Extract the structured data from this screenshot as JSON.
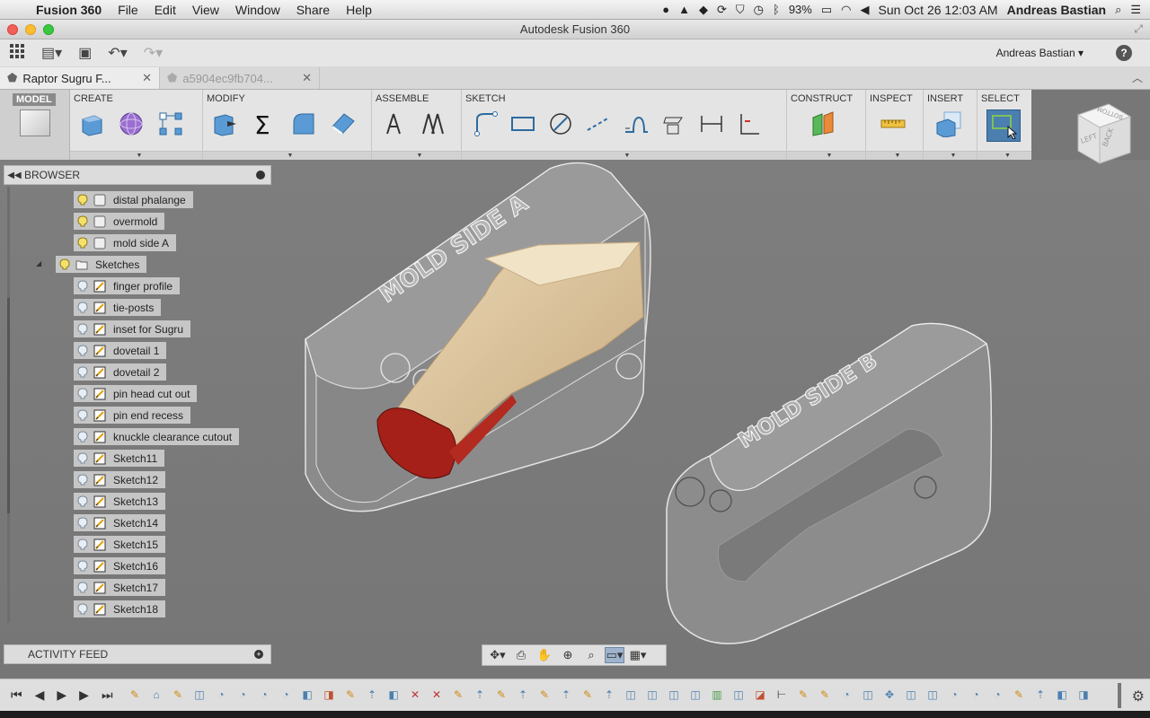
{
  "menubar": {
    "app_name": "Fusion 360",
    "menus": [
      "File",
      "Edit",
      "View",
      "Window",
      "Share",
      "Help"
    ],
    "battery": "93%",
    "datetime": "Sun Oct 26  12:03 AM",
    "user": "Andreas Bastian"
  },
  "window": {
    "title": "Autodesk Fusion 360"
  },
  "qat": {
    "user": "Andreas Bastian ▾",
    "help": "?"
  },
  "tabs": [
    {
      "label": "Raptor Sugru F..."
    },
    {
      "label": "a5904ec9fb704..."
    }
  ],
  "ribbon": {
    "workspace": "MODEL",
    "groups": {
      "create": "CREATE",
      "modify": "MODIFY",
      "assemble": "ASSEMBLE",
      "sketch": "SKETCH",
      "construct": "CONSTRUCT",
      "inspect": "INSPECT",
      "insert": "INSERT",
      "select": "SELECT"
    }
  },
  "browser": {
    "title": "BROWSER",
    "bodies": [
      "distal phalange",
      "overmold",
      "mold side A"
    ],
    "sketches_folder": "Sketches",
    "sketches": [
      "finger profile",
      "tie-posts",
      "inset for Sugru",
      "dovetail 1",
      "dovetail 2",
      "pin head cut out",
      "pin end recess",
      "knuckle clearance cutout",
      "Sketch11",
      "Sketch12",
      "Sketch13",
      "Sketch14",
      "Sketch15",
      "Sketch16",
      "Sketch17",
      "Sketch18"
    ]
  },
  "activity_feed": {
    "title": "ACTIVITY FEED"
  },
  "viewport": {
    "mold_a_label": "MOLD SIDE A",
    "mold_b_label": "MOLD SIDE B",
    "viewcube": {
      "left": "LEFT",
      "back": "BACK",
      "bottom": "BOTTOM"
    }
  },
  "colors": {
    "viewport_bg": "#7b7b7b",
    "part_tan": "#d9c29c",
    "part_red": "#a8201a",
    "select_blue": "#4a7fb0"
  }
}
